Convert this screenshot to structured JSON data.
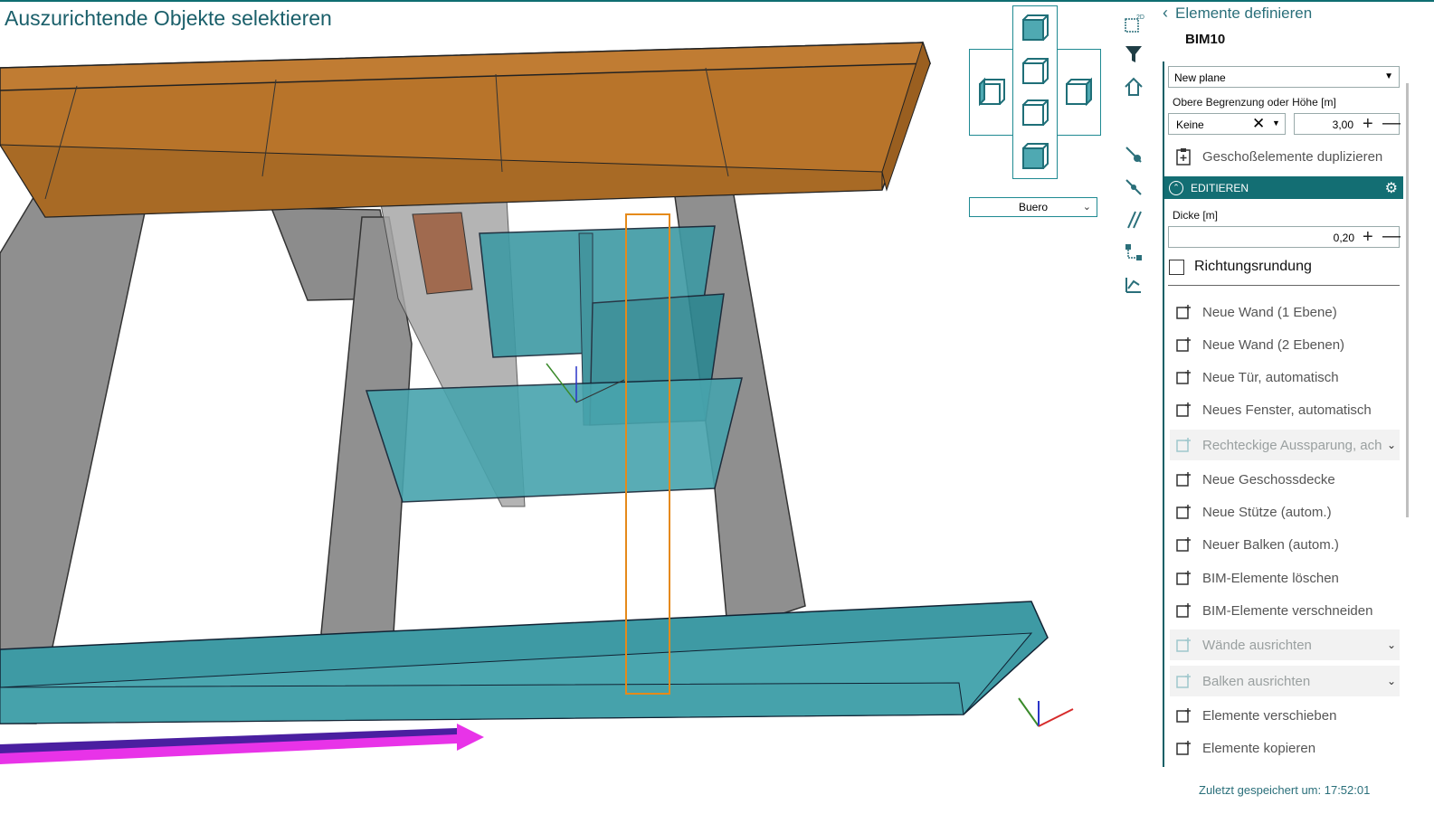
{
  "prompt": "Auszurichtende Objekte selektieren",
  "viewport": {
    "floor_selector": "Buero"
  },
  "panel": {
    "back_label": "Elemente definieren",
    "bim_id": "BIM10",
    "plane_dropdown": "New plane",
    "top_limit_label": "Obere Begrenzung oder Höhe [m]",
    "top_limit_mode": "Keine",
    "top_limit_value": "3,00",
    "duplicate_label": "Geschoßelemente duplizieren",
    "section_title": "EDITIEREN",
    "thickness_label": "Dicke [m]",
    "thickness_value": "0,20",
    "direction_rounding_label": "Richtungsrundung",
    "items": [
      {
        "label": "Neue Wand (1 Ebene)",
        "icon": "wall-icon"
      },
      {
        "label": "Neue Wand (2 Ebenen)",
        "icon": "wall-icon"
      },
      {
        "label": "Neue Tür, automatisch",
        "icon": "door-icon"
      },
      {
        "label": "Neues Fenster, automatisch",
        "icon": "window-icon"
      },
      {
        "label": "Rechteckige Aussparung, ach",
        "icon": "opening-icon"
      },
      {
        "label": "Neue Geschossdecke",
        "icon": "slab-icon"
      },
      {
        "label": "Neue Stütze (autom.)",
        "icon": "column-icon"
      },
      {
        "label": "Neuer Balken (autom.)",
        "icon": "beam-icon"
      },
      {
        "label": "BIM-Elemente löschen",
        "icon": "delete-icon"
      },
      {
        "label": "BIM-Elemente verschneiden",
        "icon": "trim-icon"
      },
      {
        "label": "Wände ausrichten",
        "icon": "align-walls-icon"
      },
      {
        "label": "Balken ausrichten",
        "icon": "align-beams-icon"
      },
      {
        "label": "Elemente verschieben",
        "icon": "move-icon"
      },
      {
        "label": "Elemente kopieren",
        "icon": "copy-icon"
      }
    ]
  },
  "status": "Zuletzt gespeichert um: 17:52:01",
  "colors": {
    "accent": "#136e73",
    "beam_orange": "#b8742a",
    "wall_cyan": "#3e9aa4",
    "column_gray": "#9a9a9a"
  }
}
